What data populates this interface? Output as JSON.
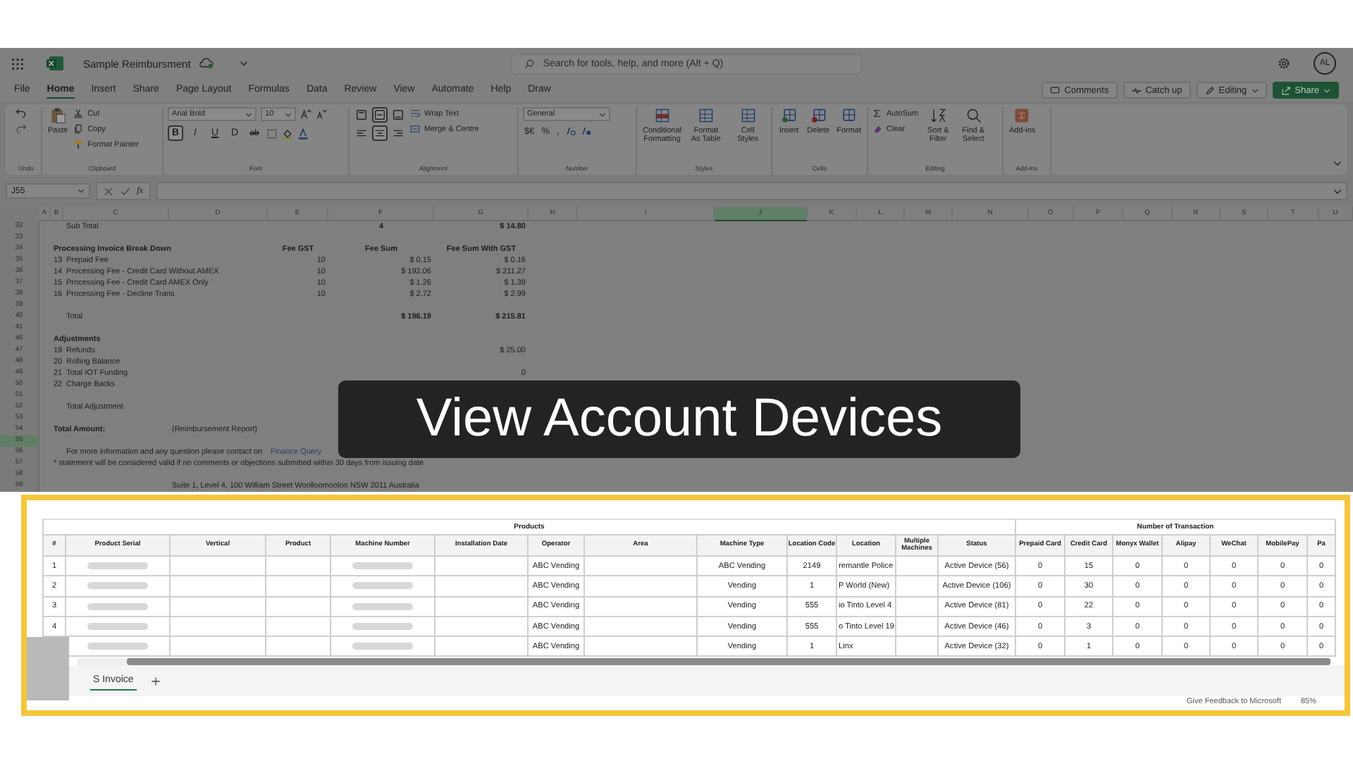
{
  "app_bar": {
    "file_name": "Sample Reimbursment",
    "search_placeholder": "Search for tools, help, and more (Alt + Q)",
    "avatar": "AL"
  },
  "menu_tabs": [
    {
      "label": "File",
      "selected": false
    },
    {
      "label": "Home",
      "selected": true
    },
    {
      "label": "Insert",
      "selected": false
    },
    {
      "label": "Share",
      "selected": false
    },
    {
      "label": "Page Layout",
      "selected": false
    },
    {
      "label": "Formulas",
      "selected": false
    },
    {
      "label": "Data",
      "selected": false
    },
    {
      "label": "Review",
      "selected": false
    },
    {
      "label": "View",
      "selected": false
    },
    {
      "label": "Automate",
      "selected": false
    },
    {
      "label": "Help",
      "selected": false
    },
    {
      "label": "Draw",
      "selected": false
    }
  ],
  "header_buttons": [
    {
      "label": "Comments",
      "kind": "comments"
    },
    {
      "label": "Catch up",
      "kind": "catchup"
    },
    {
      "label": "Editing",
      "kind": "editing"
    },
    {
      "label": "Share",
      "kind": "share"
    }
  ],
  "ribbon": {
    "undo": {
      "group": "Undo"
    },
    "clipboard": {
      "group": "Clipboard",
      "paste": "Paste",
      "actions": [
        "Cut",
        "Copy",
        "Format Painter"
      ]
    },
    "font": {
      "group": "Font",
      "font_name": "Arial Bold",
      "font_size": "10",
      "styles": [
        {
          "label": "B",
          "on": true
        },
        {
          "label": "I",
          "on": false
        },
        {
          "label": "U",
          "on": false
        },
        {
          "label": "D",
          "on": false
        },
        {
          "label": "ab",
          "on": false
        }
      ]
    },
    "alignment": {
      "group": "Alignment",
      "buttons": [
        {
          "kind": "top",
          "on": false
        },
        {
          "kind": "middle",
          "on": true
        },
        {
          "kind": "bottom",
          "on": false
        },
        {
          "kind": "left",
          "on": false
        },
        {
          "kind": "center",
          "on": true
        },
        {
          "kind": "right",
          "on": false
        }
      ],
      "wrap": "Wrap Text",
      "merge": "Merge & Centre"
    },
    "number": {
      "group": "Number",
      "format": "General",
      "symbols": [
        "$€",
        "%",
        ","
      ]
    },
    "styles": {
      "group": "Styles",
      "buttons": [
        "Conditional Formatting",
        "Format As Table",
        "Cell Styles"
      ]
    },
    "cells": {
      "group": "Cells",
      "buttons": [
        "Insert",
        "Delete",
        "Format"
      ]
    },
    "editing": {
      "group": "Editing",
      "autosum": "AutoSum",
      "clear": "Clear",
      "buttons": [
        "Sort & Filter",
        "Find & Select"
      ]
    },
    "addins": {
      "group": "Add-ins",
      "button": "Add-ins"
    }
  },
  "formula_bar": {
    "name_box": "J55",
    "function_symbol": "fx"
  },
  "sheet": {
    "columns": [
      {
        "label": "A",
        "selected": false
      },
      {
        "label": "B",
        "selected": false
      },
      {
        "label": "C",
        "selected": false
      },
      {
        "label": "D",
        "selected": false
      },
      {
        "label": "E",
        "selected": false
      },
      {
        "label": "F",
        "selected": false
      },
      {
        "label": "G",
        "selected": false
      },
      {
        "label": "H",
        "selected": false
      },
      {
        "label": "I",
        "selected": false
      },
      {
        "label": "J",
        "selected": true
      },
      {
        "label": "K",
        "selected": false
      },
      {
        "label": "L",
        "selected": false
      },
      {
        "label": "M",
        "selected": false
      },
      {
        "label": "N",
        "selected": false
      },
      {
        "label": "O",
        "selected": false
      },
      {
        "label": "P",
        "selected": false
      },
      {
        "label": "Q",
        "selected": false
      },
      {
        "label": "R",
        "selected": false
      },
      {
        "label": "S",
        "selected": false
      },
      {
        "label": "T",
        "selected": false
      },
      {
        "label": "U",
        "selected": false
      }
    ],
    "rows": [
      {
        "num": "32",
        "selected": false,
        "cells": {
          "C": {
            "text": "Sub Total",
            "kind": "label"
          },
          "F": {
            "text": "4",
            "kind": "heading"
          },
          "G": {
            "text": "$ 14.80",
            "kind": "total"
          }
        }
      },
      {
        "num": "33",
        "selected": false,
        "cells": {}
      },
      {
        "num": "34",
        "selected": false,
        "cells": {
          "B": {
            "text": "Processing Invoice Break Down",
            "kind": "title"
          },
          "E": {
            "text": "Fee GST",
            "kind": "heading"
          },
          "F": {
            "text": "Fee Sum",
            "kind": "heading"
          },
          "G": {
            "text": "Fee Sum With GST",
            "kind": "heading"
          }
        }
      },
      {
        "num": "35",
        "selected": false,
        "cells": {
          "B": {
            "text": "13",
            "kind": "value"
          },
          "C": {
            "text": "Prepaid Fee",
            "kind": "label"
          },
          "E": {
            "text": "10",
            "kind": "value"
          },
          "F": {
            "text": "$ 0.15",
            "kind": "value"
          },
          "G": {
            "text": "$ 0.16",
            "kind": "value"
          }
        }
      },
      {
        "num": "36",
        "selected": false,
        "cells": {
          "B": {
            "text": "14",
            "kind": "value"
          },
          "C": {
            "text": "Processing Fee - Credit Card Without AMEX",
            "kind": "label"
          },
          "E": {
            "text": "10",
            "kind": "value"
          },
          "F": {
            "text": "$ 192.06",
            "kind": "value"
          },
          "G": {
            "text": "$ 211.27",
            "kind": "value"
          }
        }
      },
      {
        "num": "37",
        "selected": false,
        "cells": {
          "B": {
            "text": "15",
            "kind": "value"
          },
          "C": {
            "text": "Processing Fee - Credit Card AMEX Only",
            "kind": "label"
          },
          "E": {
            "text": "10",
            "kind": "value"
          },
          "F": {
            "text": "$ 1.26",
            "kind": "value"
          },
          "G": {
            "text": "$ 1.39",
            "kind": "value"
          }
        }
      },
      {
        "num": "38",
        "selected": false,
        "cells": {
          "B": {
            "text": "16",
            "kind": "value"
          },
          "C": {
            "text": "Processing Fee - Decline Trans",
            "kind": "label"
          },
          "E": {
            "text": "10",
            "kind": "value"
          },
          "F": {
            "text": "$ 2.72",
            "kind": "value"
          },
          "G": {
            "text": "$ 2.99",
            "kind": "value"
          }
        }
      },
      {
        "num": "39",
        "selected": false,
        "cells": {}
      },
      {
        "num": "40",
        "selected": false,
        "cells": {
          "C": {
            "text": "Total",
            "kind": "label"
          },
          "F": {
            "text": "$ 196.19",
            "kind": "total"
          },
          "G": {
            "text": "$ 215.81",
            "kind": "total"
          }
        }
      },
      {
        "num": "41",
        "selected": false,
        "cells": {}
      },
      {
        "num": "46",
        "selected": false,
        "cells": {
          "B": {
            "text": "Adjustments",
            "kind": "title"
          }
        }
      },
      {
        "num": "47",
        "selected": false,
        "cells": {
          "B": {
            "text": "19",
            "kind": "value"
          },
          "C": {
            "text": "Refunds",
            "kind": "label"
          },
          "G": {
            "text": "$ 25.00",
            "kind": "value"
          }
        }
      },
      {
        "num": "48",
        "selected": false,
        "cells": {
          "B": {
            "text": "20",
            "kind": "value"
          },
          "C": {
            "text": "Rolling Balance",
            "kind": "label"
          }
        }
      },
      {
        "num": "49",
        "selected": false,
        "cells": {
          "B": {
            "text": "21",
            "kind": "value"
          },
          "C": {
            "text": "Total IOT Funding",
            "kind": "label"
          },
          "G": {
            "text": "0",
            "kind": "value"
          }
        }
      },
      {
        "num": "50",
        "selected": false,
        "cells": {
          "B": {
            "text": "22",
            "kind": "value"
          },
          "C": {
            "text": "Charge Backs",
            "kind": "label"
          }
        }
      },
      {
        "num": "51",
        "selected": false,
        "cells": {}
      },
      {
        "num": "52",
        "selected": false,
        "cells": {
          "C": {
            "text": "Total Adjustment",
            "kind": "label"
          }
        }
      },
      {
        "num": "53",
        "selected": false,
        "cells": {}
      },
      {
        "num": "54",
        "selected": false,
        "cells": {
          "B": {
            "text": "Total Amount:",
            "kind": "title"
          },
          "D": {
            "text": "(Reimbursement Report)",
            "kind": "label"
          }
        }
      },
      {
        "num": "55",
        "selected": true,
        "cells": {}
      },
      {
        "num": "56",
        "selected": false,
        "cells": {
          "C": {
            "text": "For more information and any question please contact on",
            "kind": "label"
          },
          "E": {
            "text": "Finance Query",
            "kind": "link"
          }
        }
      },
      {
        "num": "57",
        "selected": false,
        "cells": {
          "B": {
            "text": "* statement will be considered valid if no comments or objections submitted within 30 days from issuing date",
            "kind": "label"
          }
        }
      },
      {
        "num": "58",
        "selected": false,
        "cells": {}
      },
      {
        "num": "59",
        "selected": false,
        "cells": {
          "D": {
            "text": "Suite 1, Level 4, 100 William Street Woolloomooloo NSW 2011 Australia",
            "kind": "label"
          }
        }
      }
    ]
  },
  "banner": {
    "title": "View Account Devices"
  },
  "devices_panel": {
    "column_groups": [
      {
        "label": "Products",
        "columns": [
          {
            "label": "#",
            "cells": [
              "1",
              "2",
              "3",
              "4"
            ]
          },
          {
            "label": "Product Serial",
            "redacted": true
          },
          {
            "label": "Vertical"
          },
          {
            "label": "Product"
          },
          {
            "label": "Machine Number",
            "redacted": true
          },
          {
            "label": "Installation Date"
          },
          {
            "label": "Operator",
            "cells": [
              "ABC Vending",
              "ABC Vending",
              "ABC Vending",
              "ABC Vending",
              "ABC Vending"
            ]
          },
          {
            "label": "Area"
          },
          {
            "label": "Machine Type",
            "cells": [
              "ABC Vending",
              "Vending",
              "Vending",
              "Vending",
              "Vending"
            ]
          },
          {
            "label": "Location Code",
            "cells": [
              "2149",
              "1",
              "555",
              "555",
              "1"
            ]
          },
          {
            "label": "Location",
            "cells": [
              "remantle Police",
              "P World (New)",
              "io Tinto Level 4",
              "o Tinto Level 19",
              "Linx"
            ]
          },
          {
            "label": "Multiple Machines"
          },
          {
            "label": "Status",
            "cells": [
              "Active Device (56)",
              "Active Device (106)",
              "Active Device (81)",
              "Active Device (46)",
              "Active Device (32)"
            ]
          }
        ]
      },
      {
        "label": "Number of Transaction",
        "columns": [
          {
            "label": "Prepaid Card",
            "cells": [
              "0",
              "0",
              "0",
              "0",
              "0"
            ]
          },
          {
            "label": "Credit Card",
            "cells": [
              "15",
              "30",
              "22",
              "3",
              "1"
            ]
          },
          {
            "label": "Monyx Wallet",
            "cells": [
              "0",
              "0",
              "0",
              "0",
              "0"
            ]
          },
          {
            "label": "Alipay",
            "cells": [
              "0",
              "0",
              "0",
              "0",
              "0"
            ]
          },
          {
            "label": "WeChat",
            "cells": [
              "0",
              "0",
              "0",
              "0",
              "0"
            ]
          },
          {
            "label": "MobilePay",
            "cells": [
              "0",
              "0",
              "0",
              "0",
              "0"
            ]
          },
          {
            "label": "Pa",
            "cells": [
              "0",
              "0",
              "0",
              "0",
              "0"
            ]
          }
        ]
      }
    ],
    "sheet_tabs": [
      {
        "label": "S Invoice",
        "selected": true
      }
    ],
    "status_bar": {
      "feedback": "Give Feedback to Microsoft",
      "zoom": "85%"
    }
  }
}
